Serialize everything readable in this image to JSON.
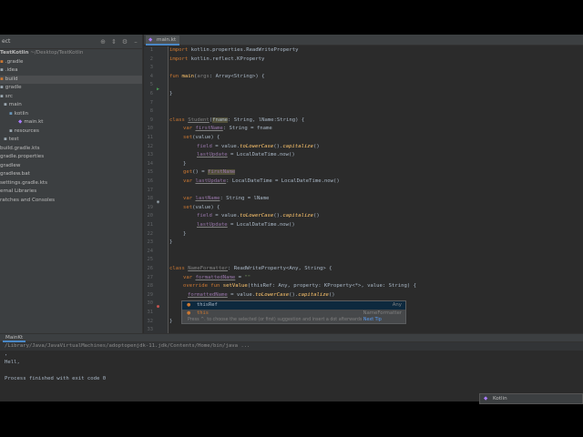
{
  "project": {
    "title": "ect",
    "root_name": "TestKotlin",
    "root_path": "~/Desktop/TestKotlin",
    "tree": [
      {
        "label": ".gradle",
        "kind": "folder-orange"
      },
      {
        "label": ".idea",
        "kind": "folder"
      },
      {
        "label": "build",
        "kind": "folder-orange"
      },
      {
        "label": "gradle",
        "kind": "folder"
      },
      {
        "label": "src",
        "kind": "folder"
      },
      {
        "label": "main",
        "kind": "folder"
      },
      {
        "label": "kotlin",
        "kind": "folder-blue"
      },
      {
        "label": "main.kt",
        "kind": "kotlin-file"
      },
      {
        "label": "resources",
        "kind": "folder"
      },
      {
        "label": "test",
        "kind": "folder"
      },
      {
        "label": "build.gradle.kts",
        "kind": "file"
      },
      {
        "label": "gradle.properties",
        "kind": "file"
      },
      {
        "label": "gradlew",
        "kind": "file"
      },
      {
        "label": "gradlew.bat",
        "kind": "file"
      },
      {
        "label": "settings.gradle.kts",
        "kind": "file"
      },
      {
        "label": "ernal Libraries",
        "kind": "lib"
      },
      {
        "label": "ratches and Consoles",
        "kind": "lib"
      }
    ]
  },
  "editor": {
    "tab_label": "main.kt",
    "line_numbers": [
      "1",
      "2",
      "3",
      "4",
      "5",
      "6",
      "7",
      "8",
      "9",
      "10",
      "11",
      "12",
      "13",
      "14",
      "15",
      "16",
      "17",
      "18",
      "19",
      "20",
      "21",
      "22",
      "23",
      "24",
      "25",
      "26",
      "27",
      "28",
      "29",
      "30",
      "31",
      "32",
      "33"
    ],
    "code": {
      "l1_a": "import ",
      "l1_b": "kotlin.properties.ReadWriteProperty",
      "l2_a": "import ",
      "l2_b": "kotlin.reflect.KProperty",
      "l4_a": "fun ",
      "l4_b": "main",
      "l4_c": "(",
      "l4_d": "args",
      "l4_e": ": Array<String>) {",
      "l6": "}",
      "l9_a": "class ",
      "l9_b": "Student",
      "l9_c": "(",
      "l9_d": "fname",
      "l9_e": ": String, ",
      "l9_f": "lName",
      "l9_g": ":String) {",
      "l10_a": "var ",
      "l10_b": "firstName",
      "l10_c": ": String = fname",
      "l11_a": "set",
      "l11_b": "(value) {",
      "l12_a": "field",
      "l12_b": " = value.",
      "l12_c": "toLowerCase",
      "l12_d": "().",
      "l12_e": "capitalize",
      "l12_f": "()",
      "l13_a": "lastUpdate",
      "l13_b": " = LocalDateTime.now()",
      "l14": "}",
      "l15_a": "get",
      "l15_b": "() = ",
      "l15_c": "firstName",
      "l16_a": "var ",
      "l16_b": "lastUpdate",
      "l16_c": ": LocalDateTime = LocalDateTime.now()",
      "l18_a": "var ",
      "l18_b": "lastName",
      "l18_c": ": String = lName",
      "l19_a": "set",
      "l19_b": "(value) {",
      "l20_a": "field",
      "l20_b": " = value.",
      "l20_c": "toLowerCase",
      "l20_d": "().",
      "l20_e": "capitalize",
      "l20_f": "()",
      "l21_a": "lastUpdate",
      "l21_b": " = LocalDateTime.now()",
      "l22": "}",
      "l23": "}",
      "l26_a": "class ",
      "l26_b": "NameFormatter",
      "l26_c": ": ReadWriteProperty<Any, String> {",
      "l27_a": "var ",
      "l27_b": "formattedName",
      "l27_c": " = ",
      "l27_d": "\"\"",
      "l28_a": "override fun ",
      "l28_b": "setValue",
      "l28_c": "(thisRef: Any, property: KProperty<*>, value: String) {",
      "l29_a": "formattedName",
      "l29_b": " = value.",
      "l29_c": "toLowerCase",
      "l29_d": "().",
      "l29_e": "capitalize",
      "l29_f": "()",
      "l30": "thi",
      "l31": "}",
      "l32": "}"
    }
  },
  "completion": {
    "items": [
      {
        "name": "thisRef",
        "type": "Any",
        "icon": "p"
      },
      {
        "name": "this",
        "type": "NameFormatter",
        "icon": "c"
      }
    ],
    "hint": "Press ^. to choose the selected (or first) suggestion and insert a dot afterwards",
    "next_tip": "Next Tip"
  },
  "run": {
    "tab_label": "MainKt",
    "output": [
      "/Library/Java/JavaVirtualMachines/adoptopenjdk-11.jdk/Contents/Home/bin/java ...",
      ",",
      "Hell,",
      "",
      "Process finished with exit code 0"
    ]
  },
  "notification": {
    "label": "Kotlin"
  },
  "colors": {
    "background": "#2b2b2b",
    "keyword": "#cc7832",
    "function": "#ffc66d",
    "property": "#9876aa",
    "string": "#6a8759",
    "accent": "#4a88c7"
  }
}
